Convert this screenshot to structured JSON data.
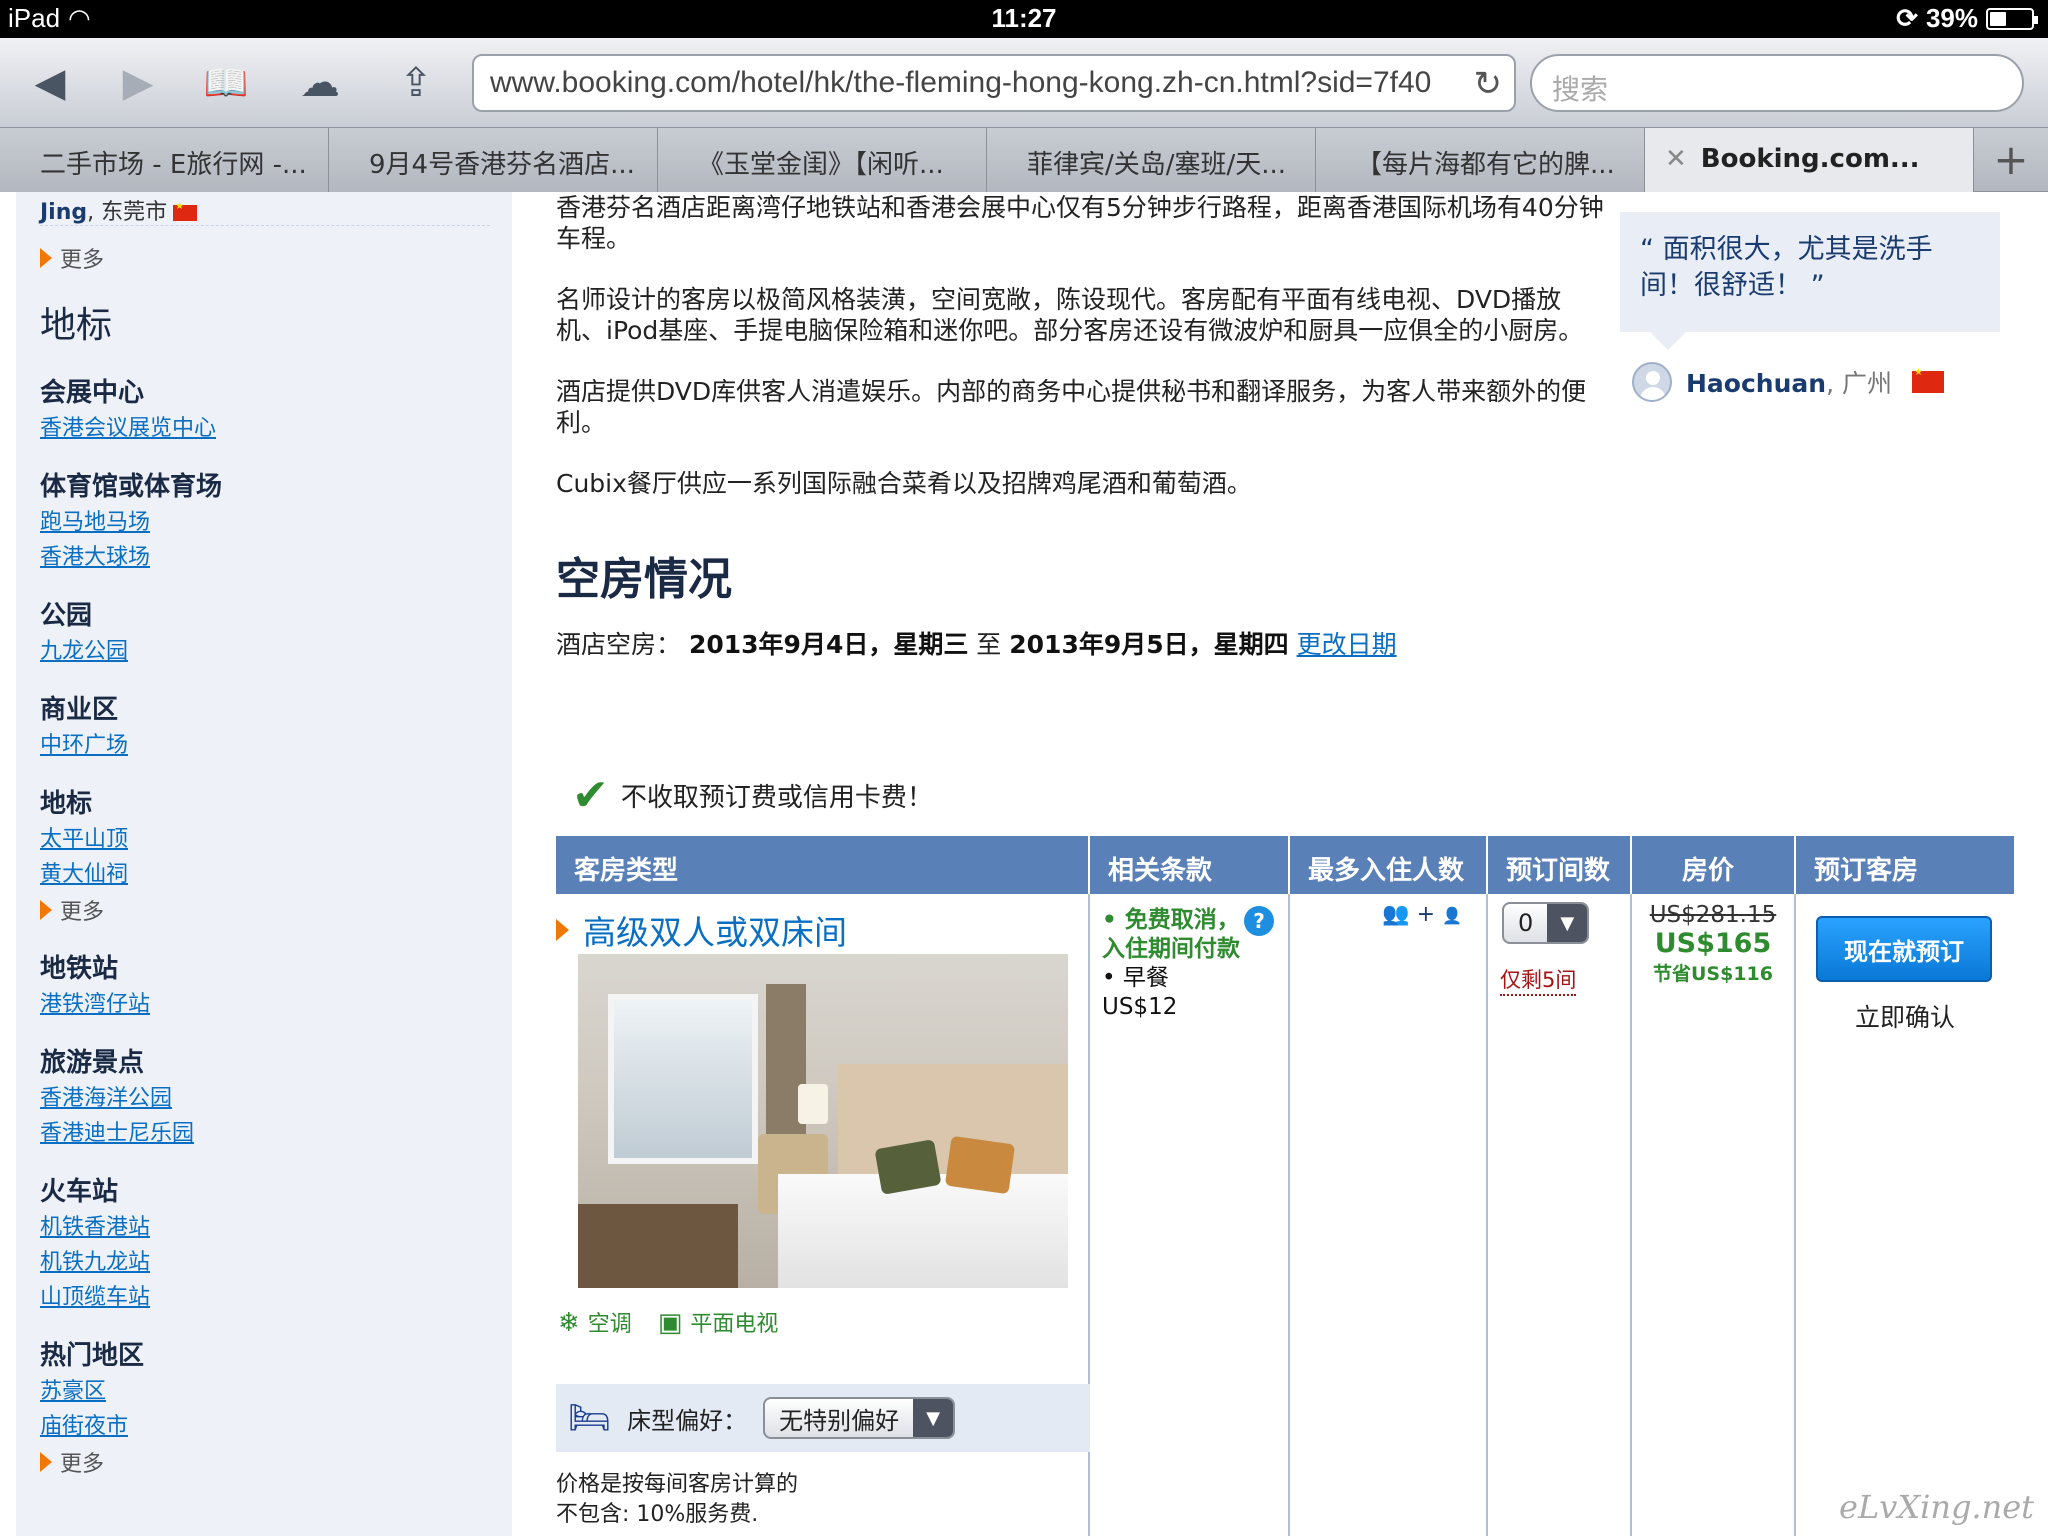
{
  "status": {
    "device": "iPad",
    "time": "11:27",
    "battery": "39%",
    "battery_fill": 0.39
  },
  "browser": {
    "url": "www.booking.com/hotel/hk/the-fleming-hong-kong.zh-cn.html?sid=7f40",
    "search_placeholder": "搜索",
    "tabs": [
      {
        "label": "二手市场 - E旅行网 -..."
      },
      {
        "label": "9月4号香港芬名酒店..."
      },
      {
        "label": "《玉堂金闺》【闲听..."
      },
      {
        "label": "菲律宾/关岛/塞班/天..."
      },
      {
        "label": "【每片海都有它的脾..."
      },
      {
        "label": "Booking.com..."
      }
    ]
  },
  "sidebar": {
    "reviewer_name": "Jing",
    "reviewer_city": ", 东莞市",
    "more_label": "更多",
    "title": "地标",
    "categories": [
      {
        "title": "会展中心",
        "links": [
          "香港会议展览中心"
        ]
      },
      {
        "title": "体育馆或体育场",
        "links": [
          "跑马地马场",
          "香港大球场"
        ]
      },
      {
        "title": "公园",
        "links": [
          "九龙公园"
        ]
      },
      {
        "title": "商业区",
        "links": [
          "中环广场"
        ]
      },
      {
        "title": "地标",
        "links": [
          "太平山顶",
          "黄大仙祠"
        ]
      },
      {
        "title": "地铁站",
        "links": [
          "港铁湾仔站"
        ]
      },
      {
        "title": "旅游景点",
        "links": [
          "香港海洋公园",
          "香港迪士尼乐园"
        ]
      },
      {
        "title": "火车站",
        "links": [
          "机铁香港站",
          "机铁九龙站",
          "山顶缆车站"
        ]
      },
      {
        "title": "热门地区",
        "links": [
          "苏豪区",
          "庙街夜市"
        ]
      }
    ]
  },
  "description": {
    "p1": "香港芬名酒店距离湾仔地铁站和香港会展中心仅有5分钟步行路程，距离香港国际机场有40分钟车程。",
    "p2": "名师设计的客房以极简风格装潢，空间宽敞，陈设现代。客房配有平面有线电视、DVD播放机、iPod基座、手提电脑保险箱和迷你吧。部分客房还设有微波炉和厨具一应俱全的小厨房。",
    "p3": "酒店提供DVD库供客人消遣娱乐。内部的商务中心提供秘书和翻译服务，为客人带来额外的便利。",
    "p4": "Cubix餐厅供应一系列国际融合菜肴以及招牌鸡尾酒和葡萄酒。"
  },
  "review": {
    "quote": "“ 面积很大，尤其是洗手间！很舒适！ ”",
    "user": "Haochuan",
    "city": ", 广州"
  },
  "availability": {
    "title": "空房情况",
    "label": "酒店空房：",
    "from": "2013年9月4日，星期三",
    "to_word": "至",
    "to": "2013年9月5日，星期四",
    "change_link": "更改日期",
    "no_fee": "不收取预订费或信用卡费！"
  },
  "table": {
    "headers": [
      "客房类型",
      "相关条款",
      "最多入住人数",
      "预订间数",
      "房价",
      "预订客房"
    ],
    "room": {
      "name": "高级双人或双床间",
      "facilities": [
        "空调",
        "平面电视"
      ],
      "bed_pref_label": "床型偏好：",
      "bed_pref_value": "无特别偏好",
      "price_note_1": "价格是按每间客房计算的",
      "price_note_2": "不包含: 10%服务费."
    },
    "policy": {
      "free_cancel": "• 免费取消，入住期间付款",
      "breakfast": "• 早餐",
      "breakfast_price": "US$12"
    },
    "occupancy": "+",
    "qty": {
      "value": "0",
      "left": "仅剩5间"
    },
    "price": {
      "old": "US$281.15",
      "new": "US$165",
      "save": "节省US$116"
    },
    "book": {
      "button": "现在就预订",
      "confirm": "立即确认"
    }
  },
  "watermark": "eLvXing.net"
}
